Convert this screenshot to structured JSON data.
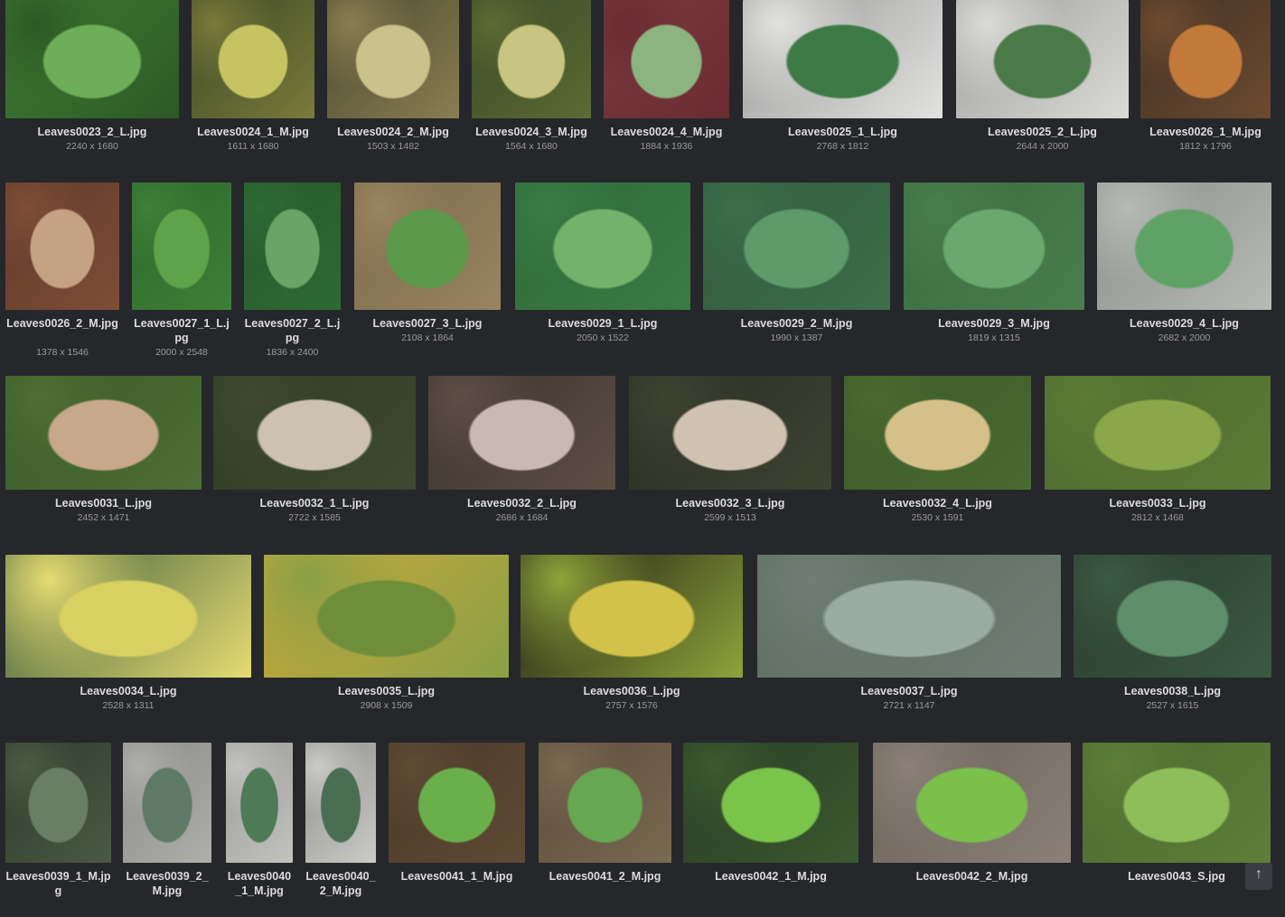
{
  "gallery": {
    "scroll_top_glyph": "↑",
    "items": [
      {
        "name": "Leaves0023_2_L.jpg",
        "dims": "2240 x 1680",
        "colors": [
          "#3f7a32",
          "#6fae58",
          "#2c5a24"
        ]
      },
      {
        "name": "Leaves0024_1_M.jpg",
        "dims": "1611 x 1680",
        "colors": [
          "#3c4a26",
          "#c6c462",
          "#7a7a3a"
        ]
      },
      {
        "name": "Leaves0024_2_M.jpg",
        "dims": "1503 x 1482",
        "colors": [
          "#4a4a2e",
          "#c9c28c",
          "#8a7e52"
        ]
      },
      {
        "name": "Leaves0024_3_M.jpg",
        "dims": "1564 x 1680",
        "colors": [
          "#3a4a26",
          "#c8c482",
          "#5c6a34"
        ]
      },
      {
        "name": "Leaves0024_4_M.jpg",
        "dims": "1884 x 1936",
        "colors": [
          "#7a3a3e",
          "#8cb480",
          "#6a2c32"
        ]
      },
      {
        "name": "Leaves0025_1_L.jpg",
        "dims": "2768 x 1812",
        "colors": [
          "#9a9a9a",
          "#3e7a46",
          "#e2e2e0"
        ]
      },
      {
        "name": "Leaves0025_2_L.jpg",
        "dims": "2644 x 2000",
        "colors": [
          "#a0a0a0",
          "#4a7a48",
          "#dadad6"
        ]
      },
      {
        "name": "Leaves0026_1_M.jpg",
        "dims": "1812 x 1796",
        "colors": [
          "#3e3228",
          "#c27a3a",
          "#6e4a2e"
        ]
      },
      {
        "name": "Leaves0026_2_M.jpg",
        "dims": "1378 x 1546",
        "colors": [
          "#5e3a2a",
          "#c6a284",
          "#7e4e36"
        ]
      },
      {
        "name": "Leaves0027_1_L.jpg",
        "dims": "2000 x 2548",
        "colors": [
          "#2e6a2e",
          "#5ea24a",
          "#3e7e36"
        ]
      },
      {
        "name": "Leaves0027_2_L.jpg",
        "dims": "1836 x 2400",
        "colors": [
          "#245a2a",
          "#6aa466",
          "#2e6a34"
        ]
      },
      {
        "name": "Leaves0027_3_L.jpg",
        "dims": "2108 x 1864",
        "colors": [
          "#7a6a4a",
          "#5a9a4a",
          "#9a8460"
        ]
      },
      {
        "name": "Leaves0029_1_L.jpg",
        "dims": "2050 x 1522",
        "colors": [
          "#2e6a3a",
          "#72b26a",
          "#3a7a44"
        ]
      },
      {
        "name": "Leaves0029_2_M.jpg",
        "dims": "1990 x 1387",
        "colors": [
          "#2e5a3e",
          "#5e9a6a",
          "#3e6e4a"
        ]
      },
      {
        "name": "Leaves0029_3_M.jpg",
        "dims": "1819 x 1315",
        "colors": [
          "#3a6a3e",
          "#6aa86e",
          "#4a7e4e"
        ]
      },
      {
        "name": "Leaves0029_4_L.jpg",
        "dims": "2682 x 2000",
        "colors": [
          "#8a8e8a",
          "#5ea266",
          "#b8bab6"
        ]
      },
      {
        "name": "Leaves0031_L.jpg",
        "dims": "2452 x 1471",
        "colors": [
          "#3a5a2a",
          "#c8a88a",
          "#4e6e34"
        ]
      },
      {
        "name": "Leaves0032_1_L.jpg",
        "dims": "2722 x 1585",
        "colors": [
          "#2e3a26",
          "#cdc2b2",
          "#3e4a30"
        ]
      },
      {
        "name": "Leaves0032_2_L.jpg",
        "dims": "2686 x 1684",
        "colors": [
          "#3a3430",
          "#c8bab0",
          "#5e4e44"
        ]
      },
      {
        "name": "Leaves0032_3_L.jpg",
        "dims": "2599 x 1513",
        "colors": [
          "#2a2e24",
          "#d0c2b0",
          "#3e4230"
        ]
      },
      {
        "name": "Leaves0032_4_L.jpg",
        "dims": "2530 x 1591",
        "colors": [
          "#3a5a2a",
          "#d6c08a",
          "#4a6a30"
        ]
      },
      {
        "name": "Leaves0033_L.jpg",
        "dims": "2812 x 1468",
        "colors": [
          "#4a6a2e",
          "#8aa84a",
          "#5e7a36"
        ]
      },
      {
        "name": "Leaves0034_L.jpg",
        "dims": "2528 x 1311",
        "colors": [
          "#3a5a3a",
          "#d8d060",
          "#e6dc72"
        ]
      },
      {
        "name": "Leaves0035_L.jpg",
        "dims": "2908 x 1509",
        "colors": [
          "#caa83a",
          "#6e8e3a",
          "#8aa046"
        ]
      },
      {
        "name": "Leaves0036_L.jpg",
        "dims": "2757 x 1576",
        "colors": [
          "#1e1a14",
          "#d2c24a",
          "#8ea43a"
        ]
      },
      {
        "name": "Leaves0037_L.jpg",
        "dims": "2721 x 1147",
        "colors": [
          "#5a6a5e",
          "#9aaca4",
          "#6e7e74"
        ]
      },
      {
        "name": "Leaves0038_L.jpg",
        "dims": "2527 x 1615",
        "colors": [
          "#2a3a2e",
          "#5e8e6a",
          "#3a5a42"
        ]
      },
      {
        "name": "Leaves0039_1_M.jpg",
        "dims": "",
        "colors": [
          "#2e3a2a",
          "#6a7e66",
          "#4a5a44"
        ]
      },
      {
        "name": "Leaves0039_2_M.jpg",
        "dims": "",
        "colors": [
          "#8a8a86",
          "#5e7a66",
          "#aeaeaa"
        ]
      },
      {
        "name": "Leaves0040_1_M.jpg",
        "dims": "",
        "colors": [
          "#9a9a96",
          "#4e7a56",
          "#c2c2be"
        ]
      },
      {
        "name": "Leaves0040_2_M.jpg",
        "dims": "",
        "colors": [
          "#8e8e8a",
          "#4a6e52",
          "#cacac6"
        ]
      },
      {
        "name": "Leaves0041_1_M.jpg",
        "dims": "",
        "colors": [
          "#4a3a2a",
          "#6ab04a",
          "#5e4a34"
        ]
      },
      {
        "name": "Leaves0041_2_M.jpg",
        "dims": "",
        "colors": [
          "#5a4a3a",
          "#66a852",
          "#7a6a52"
        ]
      },
      {
        "name": "Leaves0042_1_M.jpg",
        "dims": "",
        "colors": [
          "#2a3a26",
          "#7ac44a",
          "#3a5a2e"
        ]
      },
      {
        "name": "Leaves0042_2_M.jpg",
        "dims": "",
        "colors": [
          "#6a625a",
          "#7ac04a",
          "#8a8078"
        ]
      },
      {
        "name": "Leaves0043_S.jpg",
        "dims": "",
        "colors": [
          "#4a6a2e",
          "#8ebe5a",
          "#5e7e3a"
        ]
      }
    ]
  }
}
